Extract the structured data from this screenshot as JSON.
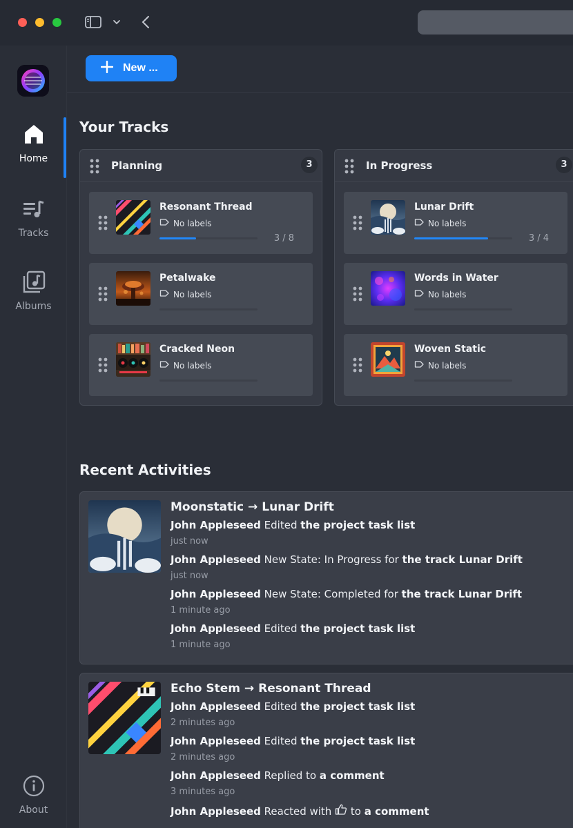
{
  "window": {
    "colors": {
      "accent": "#1f82f5",
      "background": "#2a2e37",
      "panel": "#353943",
      "card": "#454a54"
    }
  },
  "sidebar": {
    "items": [
      {
        "label": "Home",
        "icon": "home-icon",
        "active": true
      },
      {
        "label": "Tracks",
        "icon": "tracks-list-icon",
        "active": false
      },
      {
        "label": "Albums",
        "icon": "albums-icon",
        "active": false
      }
    ],
    "about_label": "About"
  },
  "toolbar": {
    "new_label": "New ..."
  },
  "tracks": {
    "title": "Your Tracks",
    "columns": [
      {
        "title": "Planning",
        "count": "3",
        "cards": [
          {
            "title": "Resonant Thread",
            "labels": "No labels",
            "progress": 0.375,
            "progress_text": "3 / 8"
          },
          {
            "title": "Petalwake",
            "labels": "No labels",
            "progress": 0,
            "progress_text": ""
          },
          {
            "title": "Cracked Neon",
            "labels": "No labels",
            "progress": 0,
            "progress_text": ""
          }
        ]
      },
      {
        "title": "In Progress",
        "count": "3",
        "cards": [
          {
            "title": "Lunar Drift",
            "labels": "No labels",
            "progress": 0.75,
            "progress_text": "3 / 4"
          },
          {
            "title": "Words in Water",
            "labels": "No labels",
            "progress": 0,
            "progress_text": ""
          },
          {
            "title": "Woven Static",
            "labels": "No labels",
            "progress": 0,
            "progress_text": ""
          }
        ]
      }
    ]
  },
  "activities": {
    "title": "Recent Activities",
    "items": [
      {
        "album": "Moonstatic",
        "track": "Lunar Drift",
        "entries": [
          {
            "user": "John Appleseed",
            "action": "Edited",
            "target": "the project task list",
            "time": "just now"
          },
          {
            "user": "John Appleseed",
            "action": "New State: In Progress for",
            "target": "the track Lunar Drift",
            "time": "just now"
          },
          {
            "user": "John Appleseed",
            "action": "New State: Completed for",
            "target": "the track Lunar Drift",
            "time": "1 minute ago"
          },
          {
            "user": "John Appleseed",
            "action": "Edited",
            "target": "the project task list",
            "time": "1 minute ago"
          }
        ]
      },
      {
        "album": "Echo Stem",
        "track": "Resonant Thread",
        "entries": [
          {
            "user": "John Appleseed",
            "action": "Edited",
            "target": "the project task list",
            "time": "2 minutes ago"
          },
          {
            "user": "John Appleseed",
            "action": "Edited",
            "target": "the project task list",
            "time": "2 minutes ago"
          },
          {
            "user": "John Appleseed",
            "action": "Replied to",
            "target": "a comment",
            "time": "3 minutes ago"
          },
          {
            "user": "John Appleseed",
            "action": "Reacted with",
            "action_icon": "thumbs-up-icon",
            "action_suffix": "to",
            "target": "a comment",
            "time": ""
          }
        ]
      }
    ]
  }
}
